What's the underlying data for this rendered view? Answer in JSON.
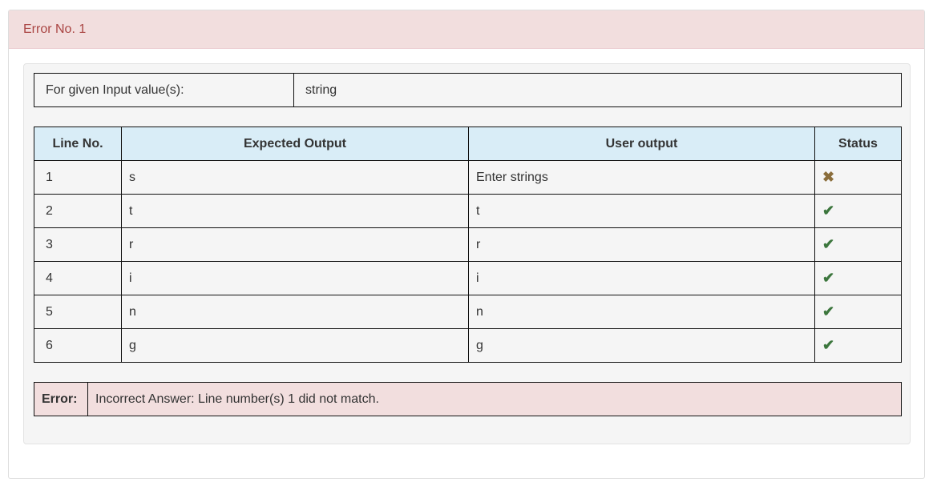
{
  "heading": {
    "title": "Error No. 1"
  },
  "input": {
    "label": "For given Input value(s):",
    "value": "string"
  },
  "output_table": {
    "headers": [
      "Line No.",
      "Expected Output",
      "User output",
      "Status"
    ],
    "rows": [
      {
        "line": "1",
        "expected": "s",
        "user": "Enter strings",
        "status": "✖",
        "status_icon": "cross-icon"
      },
      {
        "line": "2",
        "expected": "t",
        "user": "t",
        "status": "✔",
        "status_icon": "check-icon"
      },
      {
        "line": "3",
        "expected": "r",
        "user": "r",
        "status": "✔",
        "status_icon": "check-icon"
      },
      {
        "line": "4",
        "expected": "i",
        "user": "i",
        "status": "✔",
        "status_icon": "check-icon"
      },
      {
        "line": "5",
        "expected": "n",
        "user": "n",
        "status": "✔",
        "status_icon": "check-icon"
      },
      {
        "line": "6",
        "expected": "g",
        "user": "g",
        "status": "✔",
        "status_icon": "check-icon"
      }
    ]
  },
  "error": {
    "label": "Error:",
    "message": "Incorrect Answer: Line number(s) 1 did not match."
  },
  "colors": {
    "heading_bg": "#f2dede",
    "heading_text": "#a94442",
    "table_header_bg": "#d9edf7",
    "check": "#3c763d",
    "cross": "#8a6d3b"
  }
}
